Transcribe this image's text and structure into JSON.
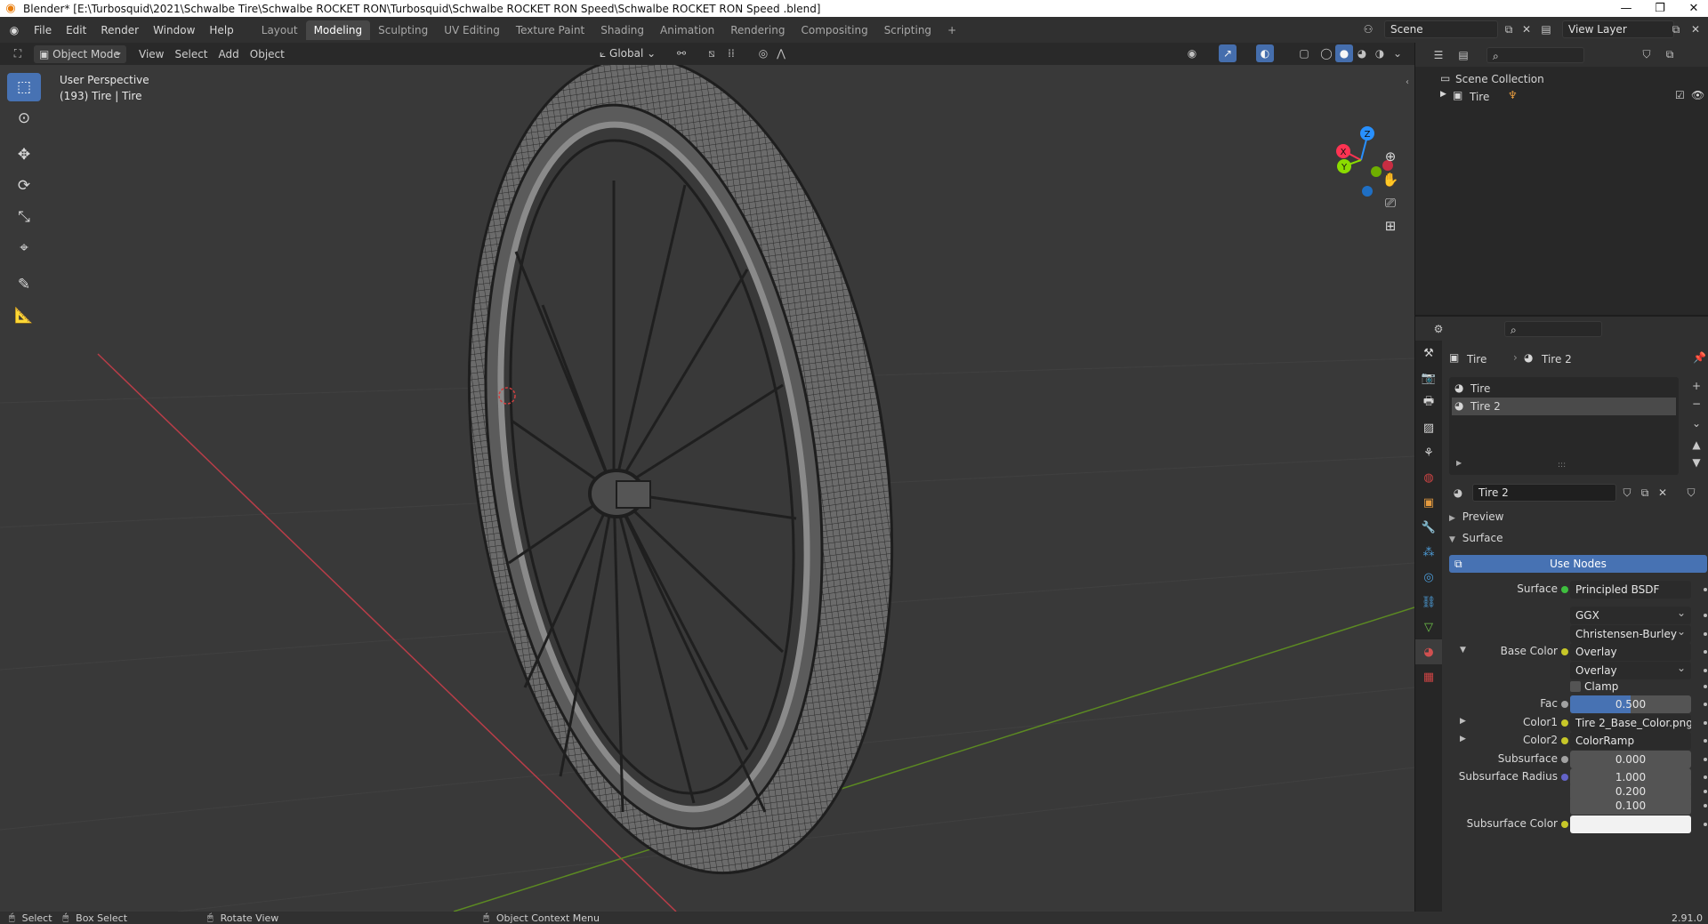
{
  "window": {
    "title": "Blender* [E:\\Turbosquid\\2021\\Schwalbe Tire\\Schwalbe ROCKET RON\\Turbosquid\\Schwalbe ROCKET RON Speed\\Schwalbe ROCKET RON Speed .blend]",
    "minimize": "—",
    "restore": "❐",
    "close": "✕"
  },
  "menu": [
    "File",
    "Edit",
    "Render",
    "Window",
    "Help"
  ],
  "workspaces": [
    "Layout",
    "Modeling",
    "Sculpting",
    "UV Editing",
    "Texture Paint",
    "Shading",
    "Animation",
    "Rendering",
    "Compositing",
    "Scripting"
  ],
  "active_workspace": "Modeling",
  "add_workspace": "+",
  "scene_name": "Scene",
  "view_layer": "View Layer",
  "viewport_header": {
    "mode": "Object Mode",
    "menus": [
      "View",
      "Select",
      "Add",
      "Object"
    ],
    "transform_orientation": "Global"
  },
  "viewport": {
    "perspective": "User Perspective",
    "object_info": "(193) Tire | Tire",
    "gizmo": {
      "x": "X",
      "y": "Y",
      "z": "Z"
    }
  },
  "outliner": {
    "root": "Scene Collection",
    "items": [
      {
        "label": "Tire"
      }
    ]
  },
  "properties": {
    "breadcrumb_object": "Tire",
    "breadcrumb_material": "Tire 2",
    "slots": [
      "Tire",
      "Tire 2"
    ],
    "active_slot": "Tire 2",
    "material_name": "Tire 2",
    "panels": {
      "preview": "Preview",
      "surface": "Surface"
    },
    "use_nodes": "Use Nodes",
    "rows": [
      {
        "label": "Surface",
        "value": "Principled BSDF",
        "socket": "#3fbf3f",
        "type": "link"
      },
      {
        "label": "",
        "value": "GGX",
        "type": "dropdown"
      },
      {
        "label": "",
        "value": "Christensen-Burley",
        "type": "dropdown"
      },
      {
        "label": "Base Color",
        "value": "Overlay",
        "socket": "#c7c729",
        "type": "link",
        "expander": "▼"
      },
      {
        "label": "",
        "value": "Overlay",
        "type": "dropdown"
      },
      {
        "label": "",
        "value": "Clamp",
        "type": "checkbox"
      },
      {
        "label": "Fac",
        "value": "0.500",
        "socket": "#a1a1a1",
        "type": "slider",
        "fill": 0.5
      },
      {
        "label": "Color1",
        "value": "Tire 2_Base_Color.png",
        "socket": "#c7c729",
        "type": "link",
        "expander": "▶"
      },
      {
        "label": "Color2",
        "value": "ColorRamp",
        "socket": "#c7c729",
        "type": "link",
        "expander": "▶"
      },
      {
        "label": "Subsurface",
        "value": "0.000",
        "socket": "#a1a1a1",
        "type": "number"
      },
      {
        "label": "Subsurface Radius",
        "value": "1.000",
        "socket": "#6363c7",
        "type": "number"
      },
      {
        "label": "",
        "value": "0.200",
        "type": "number"
      },
      {
        "label": "",
        "value": "0.100",
        "type": "number"
      },
      {
        "label": "Subsurface Color",
        "value": "",
        "socket": "#c7c729",
        "type": "color"
      }
    ]
  },
  "statusbar": {
    "items": [
      "Select",
      "Box Select",
      "Rotate View",
      "Object Context Menu"
    ],
    "version": "2.91.0"
  },
  "colors": {
    "accent": "#4772b3",
    "axis_x": "#ff3352",
    "axis_y": "#8bdc00",
    "axis_z": "#2890ff",
    "viewport_bg": "#393939"
  }
}
